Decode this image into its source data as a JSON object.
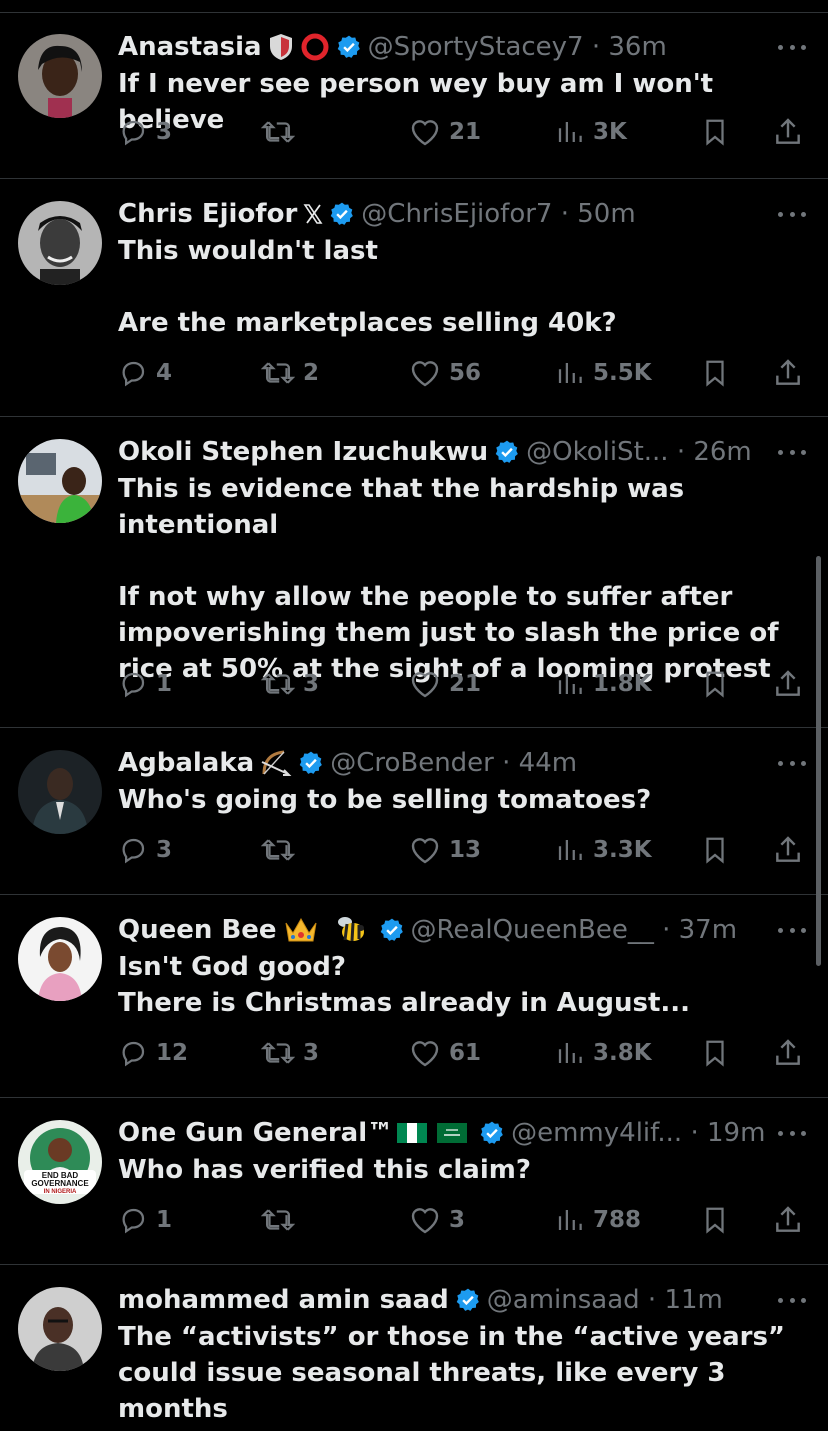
{
  "tweets": [
    {
      "name": "Anastasia",
      "emojis": [
        "shield-icon",
        "red-circle-icon"
      ],
      "handle": "@SportyStacey7",
      "time": "36m",
      "handle_time": "@SportyStacey7 · 36m",
      "text": "If I never see person wey buy am I won't believe",
      "replies": "3",
      "retweets": "",
      "likes": "21",
      "views": "3K"
    },
    {
      "name": "Chris Ejiofor",
      "emojis": [
        "x-logo-icon"
      ],
      "handle": "@ChrisEjiofor7",
      "time": "50m",
      "handle_time": "@ChrisEjiofor7 · 50m",
      "text": "This wouldn't last\n\nAre the marketplaces selling 40k?",
      "replies": "4",
      "retweets": "2",
      "likes": "56",
      "views": "5.5K"
    },
    {
      "name": "Okoli Stephen Izuchukwu",
      "emojis": [],
      "handle": "@OkoliSt...",
      "time": "26m",
      "handle_time": "@OkoliSt... · 26m",
      "text": "This is evidence that the hardship was intentional\n\nIf not why allow the people to suffer after impoverishing them just to slash the price of rice at 50% at the sight of a looming protest",
      "replies": "1",
      "retweets": "3",
      "likes": "21",
      "views": "1.8K"
    },
    {
      "name": "Agbalaka",
      "emojis": [
        "bow-and-arrow-icon"
      ],
      "handle": "@CroBender",
      "time": "44m",
      "handle_time": "@CroBender · 44m",
      "text": "Who's going to be selling tomatoes?",
      "replies": "3",
      "retweets": "",
      "likes": "13",
      "views": "3.3K"
    },
    {
      "name": "Queen Bee",
      "emojis": [
        "crown-icon",
        "bee-icon"
      ],
      "handle": "@RealQueenBee__",
      "time": "37m",
      "handle_time": "@RealQueenBee__ · 37m",
      "text": "Isn't God good?\nThere is Christmas already in August...",
      "replies": "12",
      "retweets": "3",
      "likes": "61",
      "views": "3.8K"
    },
    {
      "name": "One Gun General™",
      "emojis": [
        "nigeria-flag-icon",
        "saudi-flag-icon"
      ],
      "handle": "@emmy4lif...",
      "time": "19m",
      "handle_time": "@emmy4lif... · 19m",
      "avatar_text": [
        "END BAD",
        "GOVERNANCE",
        "IN NIGERIA"
      ],
      "text": "Who has verified this claim?",
      "replies": "1",
      "retweets": "",
      "likes": "3",
      "views": "788"
    },
    {
      "name": "mohammed amin saad",
      "emojis": [],
      "handle": "@aminsaad",
      "time": "11m",
      "handle_time": "@aminsaad · 11m",
      "text": "The “activists” or those in the “active years” could issue seasonal threats, like every 3 months",
      "replies": "",
      "retweets": "",
      "likes": "",
      "views": ""
    }
  ],
  "colors": {
    "background": "#000000",
    "text": "#e7e9ea",
    "muted": "#71767b",
    "verified": "#1d9bf0",
    "divider": "#2f3336"
  }
}
